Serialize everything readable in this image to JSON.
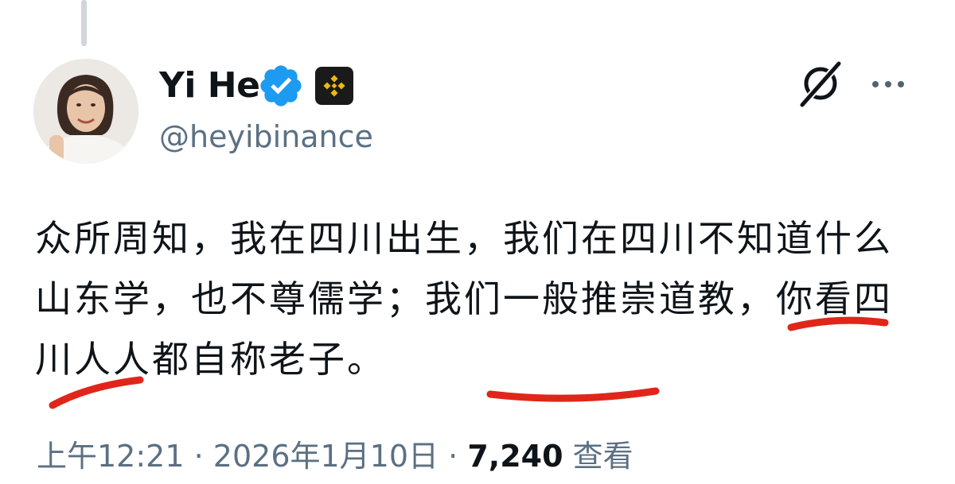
{
  "author": {
    "display_name": "Yi He",
    "handle": "@heyibinance",
    "verified": true,
    "affiliate": "binance-logo"
  },
  "tweet": {
    "text": "众所周知，我在四川出生，我们在四川不知道什么山东学，也不尊儒学；我们一般推崇道教，你看四川人人都自称老子。"
  },
  "meta": {
    "time": "上午12:21",
    "separator": "·",
    "date": "2026年1月10日",
    "views_count": "7,240",
    "views_label": "查看"
  },
  "annotation_color": "#e0261b",
  "icons": {
    "verified": "verified-badge-icon",
    "affiliate": "binance-logo-icon",
    "grok": "grok-icon",
    "more": "more-horizontal-icon"
  },
  "colors": {
    "verified_blue": "#1d9bf0",
    "binance_yellow": "#f0b90b",
    "secondary_text": "#5b7083"
  }
}
